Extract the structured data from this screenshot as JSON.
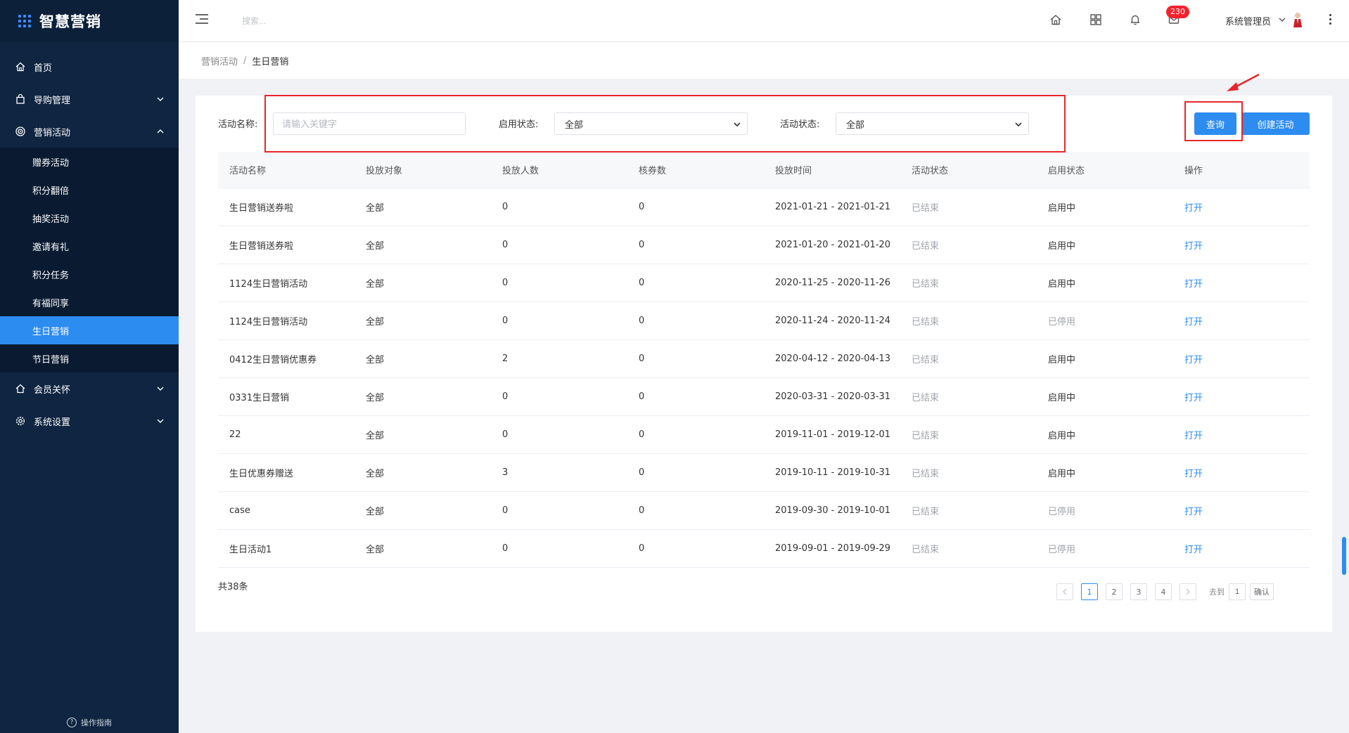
{
  "app": {
    "title": "智慧营销"
  },
  "sidebar": {
    "items": [
      {
        "label": "首页",
        "icon": "home-icon"
      },
      {
        "label": "导购管理",
        "icon": "bag-icon",
        "expandable": true
      },
      {
        "label": "营销活动",
        "icon": "target-icon",
        "expandable": true,
        "expanded": true
      }
    ],
    "sub_items": [
      "赠券活动",
      "积分翻倍",
      "抽奖活动",
      "邀请有礼",
      "积分任务",
      "有福同享",
      "生日营销",
      "节日营销"
    ],
    "active_sub": "生日营销",
    "bottom_items": [
      {
        "label": "会员关怀",
        "icon": "home-icon"
      },
      {
        "label": "系统设置",
        "icon": "gear-icon"
      }
    ],
    "guide_label": "操作指南"
  },
  "header": {
    "search_placeholder": "搜索...",
    "notification_count": "230",
    "user_name": "系统管理员"
  },
  "breadcrumb": {
    "parent": "营销活动",
    "current": "生日营销"
  },
  "filters": {
    "name_label": "活动名称:",
    "name_placeholder": "请输入关键字",
    "enable_label": "启用状态:",
    "enable_value": "全部",
    "status_label": "活动状态:",
    "status_value": "全部",
    "query_button": "查询",
    "create_button": "创建活动"
  },
  "table": {
    "columns": [
      "活动名称",
      "投放对象",
      "投放人数",
      "核券数",
      "投放时间",
      "活动状态",
      "启用状态",
      "操作"
    ],
    "rows": [
      [
        "生日营销送券啦",
        "全部",
        "0",
        "0",
        "2021-01-21 - 2021-01-21",
        "已结束",
        "启用中",
        "打开"
      ],
      [
        "生日营销送券啦",
        "全部",
        "0",
        "0",
        "2021-01-20 - 2021-01-20",
        "已结束",
        "启用中",
        "打开"
      ],
      [
        "1124生日营销活动",
        "全部",
        "0",
        "0",
        "2020-11-25 - 2020-11-26",
        "已结束",
        "启用中",
        "打开"
      ],
      [
        "1124生日营销活动",
        "全部",
        "0",
        "0",
        "2020-11-24 - 2020-11-24",
        "已结束",
        "已停用",
        "打开"
      ],
      [
        "0412生日营销优惠券",
        "全部",
        "2",
        "0",
        "2020-04-12 - 2020-04-13",
        "已结束",
        "启用中",
        "打开"
      ],
      [
        "0331生日营销",
        "全部",
        "0",
        "0",
        "2020-03-31 - 2020-03-31",
        "已结束",
        "启用中",
        "打开"
      ],
      [
        "22",
        "全部",
        "0",
        "0",
        "2019-11-01 - 2019-12-01",
        "已结束",
        "启用中",
        "打开"
      ],
      [
        "生日优惠券赠送",
        "全部",
        "3",
        "0",
        "2019-10-11 - 2019-10-31",
        "已结束",
        "启用中",
        "打开"
      ],
      [
        "case",
        "全部",
        "0",
        "0",
        "2019-09-30 - 2019-10-01",
        "已结束",
        "已停用",
        "打开"
      ],
      [
        "生日活动1",
        "全部",
        "0",
        "0",
        "2019-09-01 - 2019-09-29",
        "已结束",
        "已停用",
        "打开"
      ]
    ],
    "total": "共38条"
  },
  "pagination": {
    "pages": [
      "1",
      "2",
      "3",
      "4"
    ],
    "current": "1",
    "goto_label": "去到",
    "goto_value": "1",
    "confirm": "确认"
  },
  "colors": {
    "sidebar_bg": "#0f2541",
    "accent": "#2d8cf0",
    "highlight_red": "#e8262b",
    "badge": "#f5222d"
  }
}
